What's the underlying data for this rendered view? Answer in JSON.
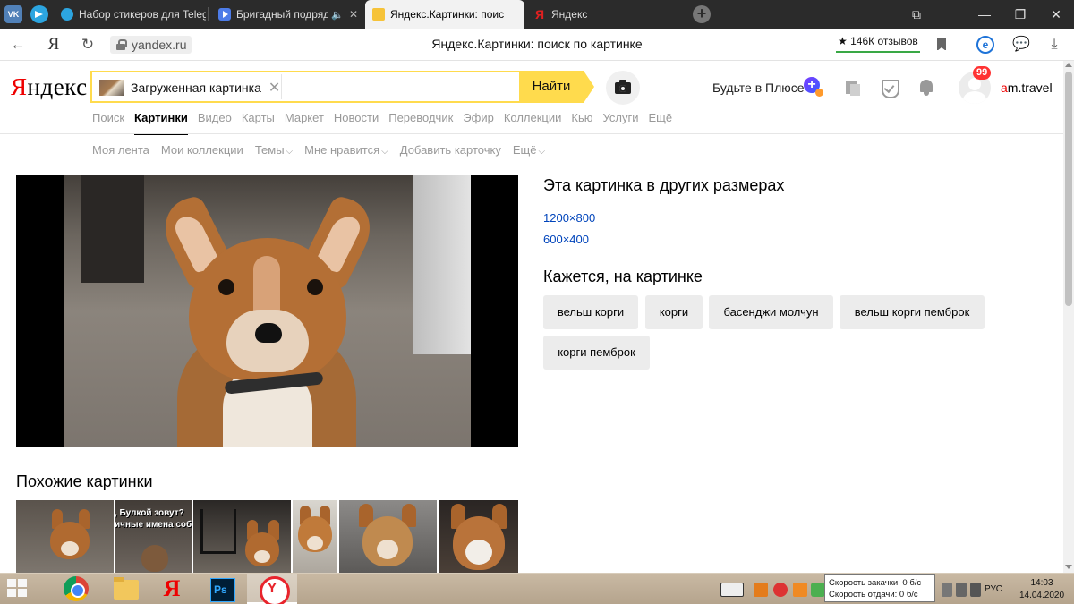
{
  "browser": {
    "pinned_tabs": [
      {
        "name": "vk",
        "label": "VK"
      },
      {
        "name": "telegram"
      }
    ],
    "tabs": [
      {
        "title": "Набор стикеров для Teleg"
      },
      {
        "title": "Бригадный подряд"
      },
      {
        "title": "Яндекс.Картинки: поис"
      },
      {
        "title": "Яндекс"
      }
    ],
    "page_title": "Яндекс.Картинки: поиск по картинке",
    "url": "yandex.ru",
    "reviews": "★ 146К отзывов",
    "nav_icons": [
      "back-arrow-icon",
      "yandex-y-icon",
      "reload-icon"
    ],
    "right_icons": [
      "bookmark-icon",
      "e-icon",
      "chat-icon",
      "download-icon"
    ],
    "window_controls": [
      "tab-list-icon",
      "minimize-icon",
      "restore-icon",
      "close-icon"
    ]
  },
  "header": {
    "logo_first": "Я",
    "logo_rest": "ндекс",
    "search_chip": "Загруженная картинка",
    "search_value": "",
    "find_button": "Найти",
    "plus_text": "Будьте в Плюсе",
    "notification_count": "99",
    "user_first": "a",
    "user_rest": "m.travel"
  },
  "services": [
    {
      "label": "Поиск"
    },
    {
      "label": "Картинки",
      "active": true
    },
    {
      "label": "Видео"
    },
    {
      "label": "Карты"
    },
    {
      "label": "Маркет"
    },
    {
      "label": "Новости"
    },
    {
      "label": "Переводчик"
    },
    {
      "label": "Эфир"
    },
    {
      "label": "Коллекции"
    },
    {
      "label": "Кью"
    },
    {
      "label": "Услуги"
    },
    {
      "label": "Ещё"
    }
  ],
  "subnav": [
    {
      "label": "Моя лента"
    },
    {
      "label": "Мои коллекции"
    },
    {
      "label": "Темы"
    },
    {
      "label": "Мне нравится"
    },
    {
      "label": "Добавить карточку"
    },
    {
      "label": "Ещё"
    }
  ],
  "sizes": {
    "heading": "Эта картинка в других размерах",
    "links": [
      "1200×800",
      "600×400"
    ]
  },
  "looks_like": {
    "heading": "Кажется, на картинке",
    "tags": [
      "вельш корги",
      "корги",
      "басенджи молчун",
      "вельш корги пемброк",
      "корги пемброк"
    ]
  },
  "similar": {
    "heading": "Похожие картинки",
    "caption_line1": ", Булкой зовут?",
    "caption_line2": "ичные имена собак."
  },
  "taskbar": {
    "apps": [
      "chrome-icon",
      "file-explorer-icon",
      "yandex-icon",
      "photoshop-icon",
      "yandex-browser-icon"
    ],
    "ps_label": "Ps",
    "ybrowser_label": "Y",
    "yandex_label": "Я",
    "tooltip_line1": "Скорость закачки: 0 б/с",
    "tooltip_line2": "Скорость отдачи: 0 б/с",
    "lang": "РУС",
    "time": "14:03",
    "date": "14.04.2020"
  },
  "colors": {
    "yandex_red": "#e00000",
    "search_yellow": "#ffdb4d",
    "link_blue": "#0044bb",
    "tag_bg": "#ececec"
  }
}
